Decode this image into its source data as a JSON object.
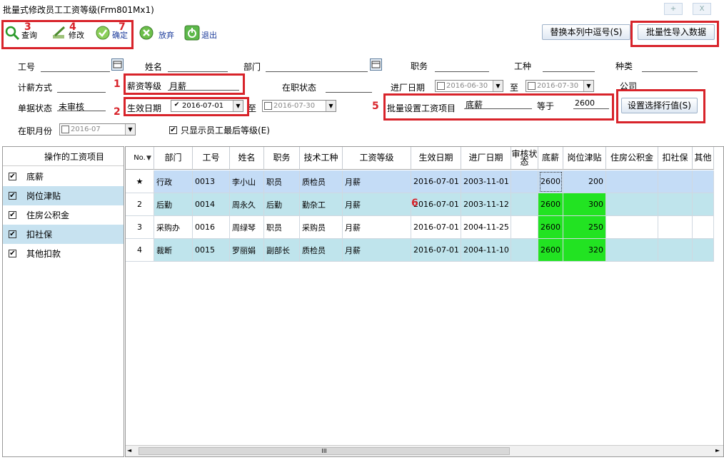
{
  "window": {
    "title": "批量式修改员工工资等级(Frm801Mx1)",
    "btn_min": "+",
    "btn_close": "X"
  },
  "toolbar": {
    "query": "查询",
    "modify": "修改",
    "confirm": "确定",
    "abandon": "放弃",
    "exit": "退出",
    "replace_comma": "替换本列中逗号(S)",
    "batch_import": "批量性导入数据"
  },
  "annotations": {
    "n1": "1",
    "n2": "2",
    "n3": "3",
    "n4": "4",
    "n5": "5",
    "n6": "6",
    "n7": "7"
  },
  "form": {
    "emp_no": "工号",
    "name": "姓名",
    "dept": "部门",
    "position": "职务",
    "work_type": "工种",
    "category": "种类",
    "pay_method": "计薪方式",
    "salary_grade_label": "薪资等级",
    "salary_grade_value": "月薪",
    "job_status": "在职状态",
    "join_date": "进厂日期",
    "join_from": "2016-06-30",
    "to1": "至",
    "join_to": "2016-07-30",
    "company": "公司",
    "doc_status_label": "单据状态",
    "doc_status_value": "未审核",
    "effective_label": "生效日期",
    "effective_from": "2016-07-01",
    "to2": "至",
    "effective_to": "2016-07-30",
    "batch_label": "批量设置工资项目",
    "batch_item": "底薪",
    "equals": "等于",
    "batch_value": "2600",
    "set_value_btn": "设置选择行值(S)",
    "month_label": "在职月份",
    "month_value": "2016-07",
    "only_last_grade": "只显示员工最后等级(E)"
  },
  "left_panel": {
    "header": "操作的工资项目",
    "items": [
      {
        "label": "底薪",
        "checked": true
      },
      {
        "label": "岗位津贴",
        "checked": true
      },
      {
        "label": "住房公积金",
        "checked": true
      },
      {
        "label": "扣社保",
        "checked": true
      },
      {
        "label": "其他扣款",
        "checked": true
      }
    ]
  },
  "grid": {
    "columns": [
      "No.",
      "部门",
      "工号",
      "姓名",
      "职务",
      "技术工种",
      "工资等级",
      "生效日期",
      "进厂日期",
      "审核状态",
      "底薪",
      "岗位津贴",
      "住房公积金",
      "扣社保",
      "其他"
    ],
    "rows": [
      {
        "no": "★",
        "dept": "行政",
        "id": "0013",
        "name": "李小山",
        "pos": "职员",
        "tech": "质检员",
        "grade": "月薪",
        "eff": "2016-07-01",
        "join": "2003-11-01",
        "audit": "",
        "base": "2600",
        "allow": "200",
        "house": "",
        "ss": "",
        "other": ""
      },
      {
        "no": "2",
        "dept": "后勤",
        "id": "0014",
        "name": "周永久",
        "pos": "后勤",
        "tech": "勤杂工",
        "grade": "月薪",
        "eff": "2016-07-01",
        "join": "2003-11-12",
        "audit": "",
        "base": "2600",
        "allow": "300",
        "house": "",
        "ss": "",
        "other": ""
      },
      {
        "no": "3",
        "dept": "采购办",
        "id": "0016",
        "name": "周绿琴",
        "pos": "职员",
        "tech": "采购员",
        "grade": "月薪",
        "eff": "2016-07-01",
        "join": "2004-11-25",
        "audit": "",
        "base": "2600",
        "allow": "250",
        "house": "",
        "ss": "",
        "other": ""
      },
      {
        "no": "4",
        "dept": "裁断",
        "id": "0015",
        "name": "罗丽娟",
        "pos": "副部长",
        "tech": "质检员",
        "grade": "月薪",
        "eff": "2016-07-01",
        "join": "2004-11-10",
        "audit": "",
        "base": "2600",
        "allow": "320",
        "house": "",
        "ss": "",
        "other": ""
      }
    ]
  },
  "colors": {
    "annotation_red": "#d8232a",
    "selected_row": "#c4dcf6",
    "alt_row": "#bfe4ec",
    "highlight_green": "#22e322"
  }
}
